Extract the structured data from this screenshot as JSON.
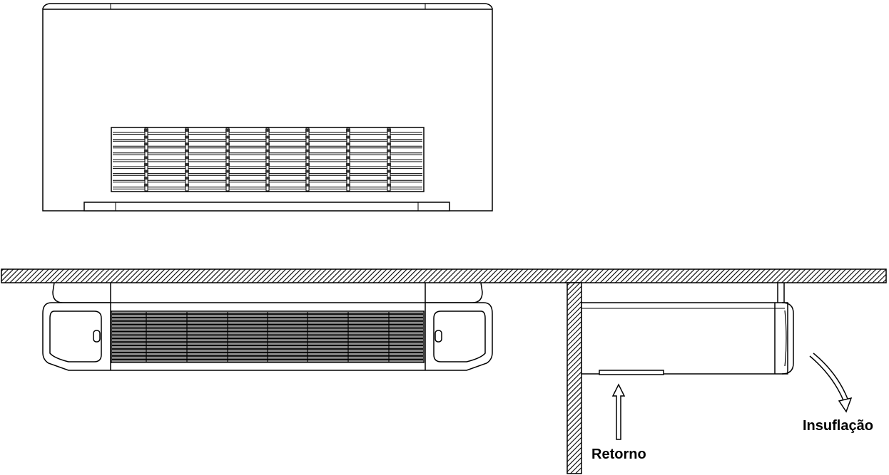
{
  "labels": {
    "retorno": "Retorno",
    "insuflacao": "Insuflação"
  },
  "colors": {
    "line": "#000000",
    "background": "#ffffff",
    "grille_fill": "#8a8a8a"
  }
}
